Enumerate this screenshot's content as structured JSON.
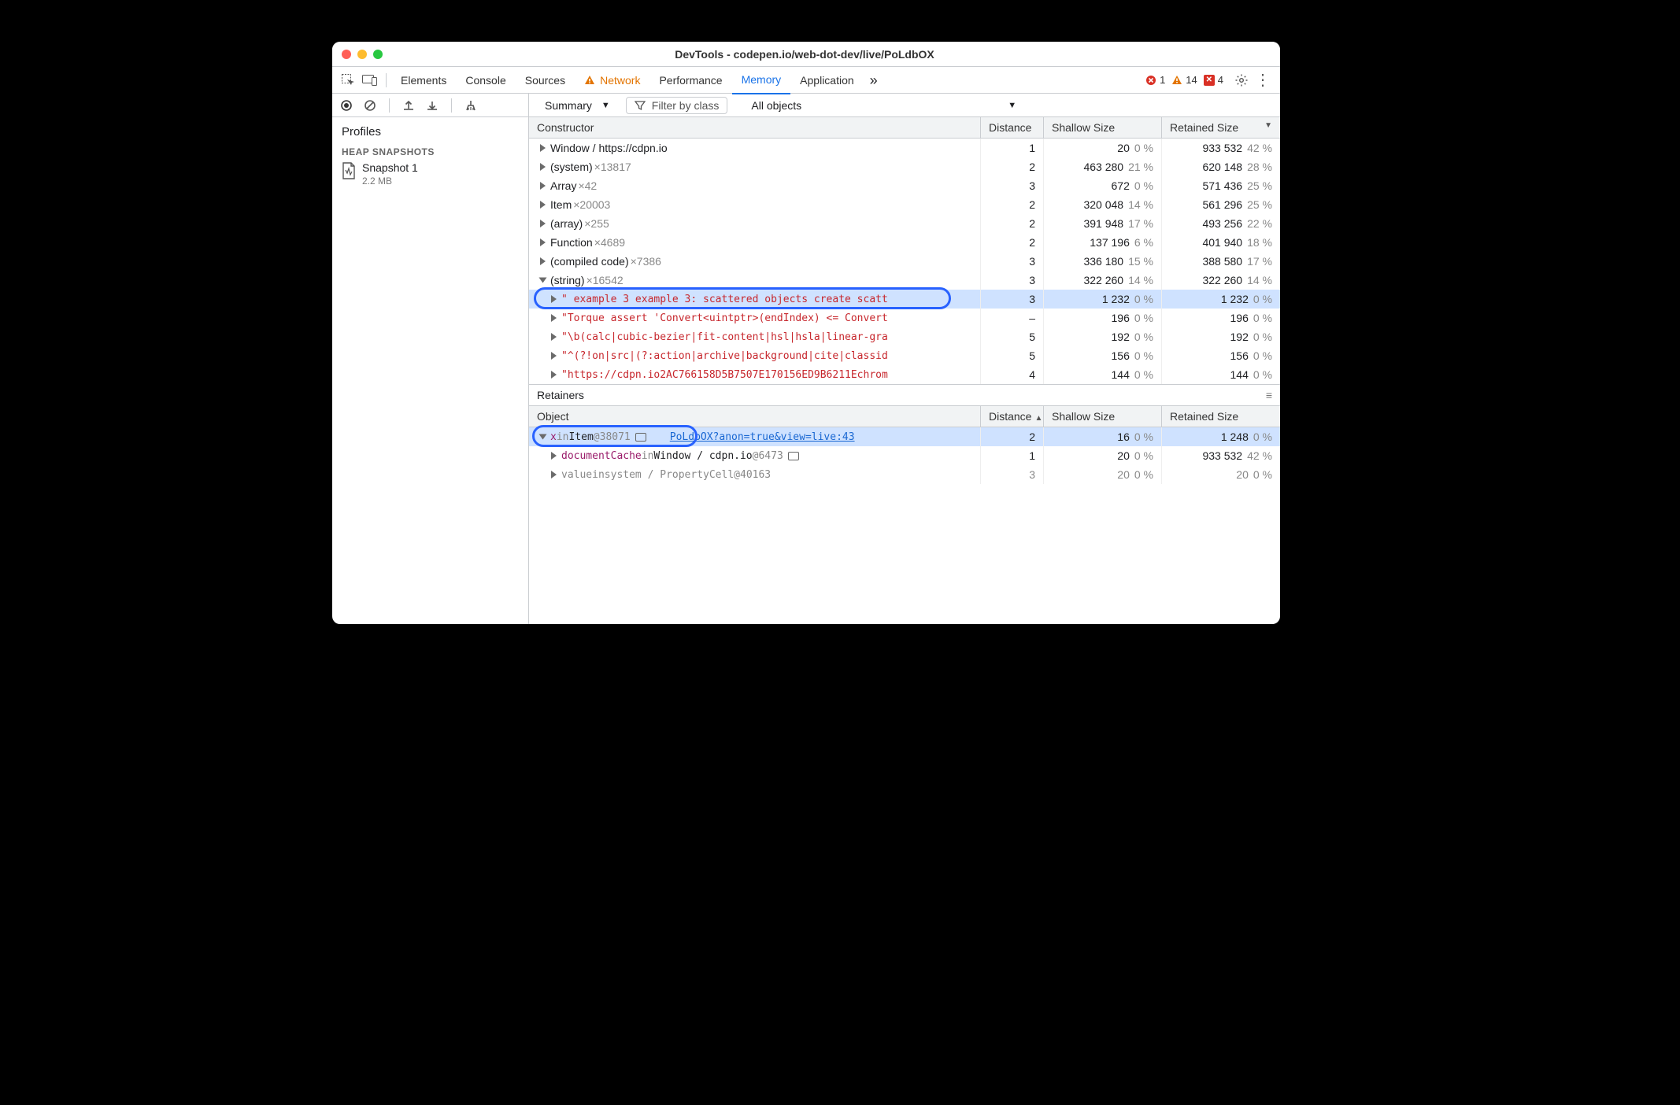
{
  "title": "DevTools - codepen.io/web-dot-dev/live/PoLdbOX",
  "tabs": {
    "elements": "Elements",
    "console": "Console",
    "sources": "Sources",
    "network": "Network",
    "performance": "Performance",
    "memory": "Memory",
    "application": "Application"
  },
  "issues": {
    "errors": "1",
    "warnings": "14",
    "blocked": "4"
  },
  "sidebar": {
    "profiles_label": "Profiles",
    "heap_heading": "HEAP SNAPSHOTS",
    "snapshot": {
      "name": "Snapshot 1",
      "size": "2.2 MB"
    }
  },
  "toolbar": {
    "view": "Summary",
    "filter_placeholder": "Filter by class",
    "scope": "All objects"
  },
  "headers": {
    "constructor": "Constructor",
    "distance": "Distance",
    "shallow": "Shallow Size",
    "retained": "Retained Size"
  },
  "rows": [
    {
      "lvl": 0,
      "name": "Window / https://cdpn.io",
      "mult": "",
      "dist": "1",
      "sh": "20",
      "shp": "0 %",
      "rt": "933 532",
      "rtp": "42 %"
    },
    {
      "lvl": 0,
      "name": "(system)",
      "mult": "×13817",
      "dist": "2",
      "sh": "463 280",
      "shp": "21 %",
      "rt": "620 148",
      "rtp": "28 %"
    },
    {
      "lvl": 0,
      "name": "Array",
      "mult": "×42",
      "dist": "3",
      "sh": "672",
      "shp": "0 %",
      "rt": "571 436",
      "rtp": "25 %"
    },
    {
      "lvl": 0,
      "name": "Item",
      "mult": "×20003",
      "dist": "2",
      "sh": "320 048",
      "shp": "14 %",
      "rt": "561 296",
      "rtp": "25 %"
    },
    {
      "lvl": 0,
      "name": "(array)",
      "mult": "×255",
      "dist": "2",
      "sh": "391 948",
      "shp": "17 %",
      "rt": "493 256",
      "rtp": "22 %"
    },
    {
      "lvl": 0,
      "name": "Function",
      "mult": "×4689",
      "dist": "2",
      "sh": "137 196",
      "shp": "6 %",
      "rt": "401 940",
      "rtp": "18 %"
    },
    {
      "lvl": 0,
      "name": "(compiled code)",
      "mult": "×7386",
      "dist": "3",
      "sh": "336 180",
      "shp": "15 %",
      "rt": "388 580",
      "rtp": "17 %"
    },
    {
      "lvl": 0,
      "open": true,
      "name": "(string)",
      "mult": "×16542",
      "dist": "3",
      "sh": "322 260",
      "shp": "14 %",
      "rt": "322 260",
      "rtp": "14 %"
    },
    {
      "lvl": 1,
      "str": true,
      "hl": true,
      "name": "\" example 3 example 3: scattered objects create scatt",
      "dist": "3",
      "sh": "1 232",
      "shp": "0 %",
      "rt": "1 232",
      "rtp": "0 %"
    },
    {
      "lvl": 1,
      "str": true,
      "name": "\"Torque assert 'Convert<uintptr>(endIndex) <= Convert",
      "dist": "–",
      "sh": "196",
      "shp": "0 %",
      "rt": "196",
      "rtp": "0 %"
    },
    {
      "lvl": 1,
      "str": true,
      "name": "\"\\b(calc|cubic-bezier|fit-content|hsl|hsla|linear-gra",
      "dist": "5",
      "sh": "192",
      "shp": "0 %",
      "rt": "192",
      "rtp": "0 %"
    },
    {
      "lvl": 1,
      "str": true,
      "name": "\"^(?!on|src|(?:action|archive|background|cite|classid",
      "dist": "5",
      "sh": "156",
      "shp": "0 %",
      "rt": "156",
      "rtp": "0 %"
    },
    {
      "lvl": 1,
      "str": true,
      "name": "\"https://cdpn.io2AC766158D5B7507E170156ED9B6211Echrom",
      "dist": "4",
      "sh": "144",
      "shp": "0 %",
      "rt": "144",
      "rtp": "0 %"
    }
  ],
  "retainers": {
    "title": "Retainers",
    "headers": {
      "object": "Object",
      "distance": "Distance",
      "shallow": "Shallow Size",
      "retained": "Retained Size"
    },
    "rows": [
      {
        "open": true,
        "hl": true,
        "pill": true,
        "prop": "x",
        "in": "in",
        "obj": "Item",
        "id": "@38071",
        "objicon": true,
        "src": "PoLdbOX?anon=true&view=live:43",
        "dist": "2",
        "sh": "16",
        "shp": "0 %",
        "rt": "1 248",
        "rtp": "0 %"
      },
      {
        "open": false,
        "lvl": 1,
        "prop": "documentCache",
        "in": "in",
        "obj": "Window / cdpn.io",
        "id": "@6473",
        "objicon": true,
        "dist": "1",
        "sh": "20",
        "shp": "0 %",
        "rt": "933 532",
        "rtp": "42 %"
      },
      {
        "open": false,
        "lvl": 1,
        "gray": true,
        "prop": "value",
        "in": "in",
        "obj": "system / PropertyCell",
        "id": "@40163",
        "dist": "3",
        "sh": "20",
        "shp": "0 %",
        "rt": "20",
        "rtp": "0 %"
      }
    ]
  }
}
